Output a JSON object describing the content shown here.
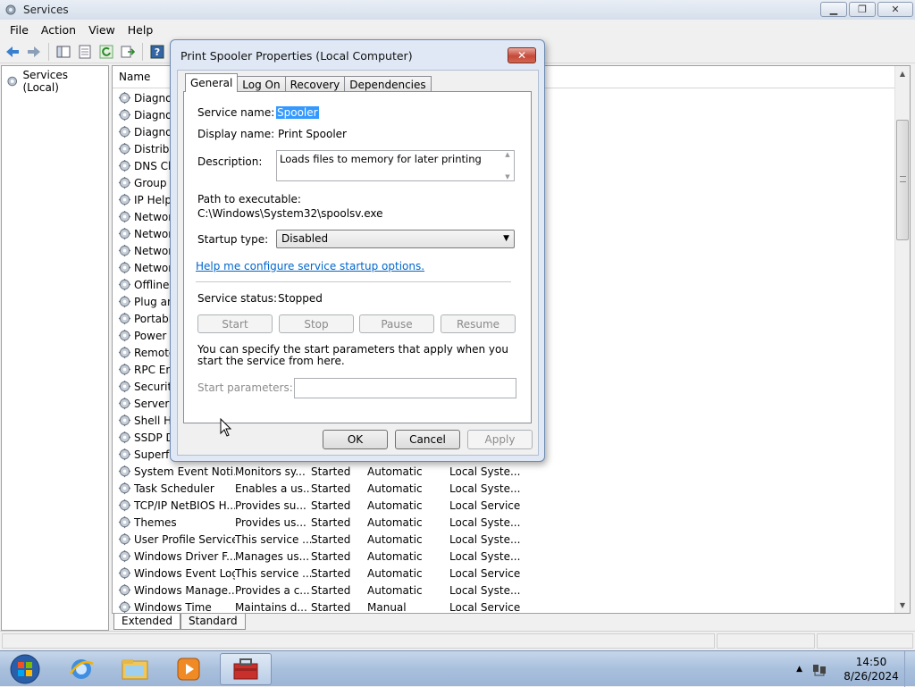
{
  "main_window": {
    "title": "Services",
    "menu": [
      "File",
      "Action",
      "View",
      "Help"
    ],
    "tree_root": "Services (Local)",
    "column_header_name": "Name",
    "partial_service_names": [
      "Diagnos",
      "Diagnos",
      "Diagnos",
      "Distribu",
      "DNS Cli",
      "Group P",
      "IP Helpe",
      "Networ",
      "Networ",
      "Networ",
      "Networ",
      "Offline",
      "Plug an",
      "Portable",
      "Power",
      "Remote",
      "RPC End",
      "Security",
      "Server",
      "Shell Ha",
      "SSDP Di",
      "Superfe"
    ],
    "services": [
      {
        "name": "System Event Noti...",
        "description": "Monitors sy...",
        "status": "Started",
        "startup": "Automatic",
        "logon": "Local Syste..."
      },
      {
        "name": "Task Scheduler",
        "description": "Enables a us...",
        "status": "Started",
        "startup": "Automatic",
        "logon": "Local Syste..."
      },
      {
        "name": "TCP/IP NetBIOS H...",
        "description": "Provides su...",
        "status": "Started",
        "startup": "Automatic",
        "logon": "Local Service"
      },
      {
        "name": "Themes",
        "description": "Provides us...",
        "status": "Started",
        "startup": "Automatic",
        "logon": "Local Syste..."
      },
      {
        "name": "User Profile Service",
        "description": "This service ...",
        "status": "Started",
        "startup": "Automatic",
        "logon": "Local Syste..."
      },
      {
        "name": "Windows Driver F...",
        "description": "Manages us...",
        "status": "Started",
        "startup": "Automatic",
        "logon": "Local Syste..."
      },
      {
        "name": "Windows Event Log",
        "description": "This service ...",
        "status": "Started",
        "startup": "Automatic",
        "logon": "Local Service"
      },
      {
        "name": "Windows Manage...",
        "description": "Provides a c...",
        "status": "Started",
        "startup": "Automatic",
        "logon": "Local Syste..."
      },
      {
        "name": "Windows Time",
        "description": "Maintains d...",
        "status": "Started",
        "startup": "Manual",
        "logon": "Local Service"
      }
    ],
    "view_tabs": [
      "Extended",
      "Standard"
    ]
  },
  "dialog": {
    "title": "Print Spooler Properties (Local Computer)",
    "tabs": [
      "General",
      "Log On",
      "Recovery",
      "Dependencies"
    ],
    "service_name_label": "Service name:",
    "service_name_value": "Spooler",
    "display_name_label": "Display name:",
    "display_name_value": "Print Spooler",
    "description_label": "Description:",
    "description_value": "Loads files to memory for later printing",
    "path_label": "Path to executable:",
    "path_value": "C:\\Windows\\System32\\spoolsv.exe",
    "startup_type_label": "Startup type:",
    "startup_type_value": "Disabled",
    "help_link": "Help me configure service startup options.",
    "status_label": "Service status:",
    "status_value": "Stopped",
    "buttons": {
      "start": "Start",
      "stop": "Stop",
      "pause": "Pause",
      "resume": "Resume"
    },
    "params_hint": "You can specify the start parameters that apply when you start the service from here.",
    "params_label": "Start parameters:",
    "params_value": "",
    "ok": "OK",
    "cancel": "Cancel",
    "apply": "Apply"
  },
  "taskbar": {
    "time": "14:50",
    "date": "8/26/2024"
  }
}
